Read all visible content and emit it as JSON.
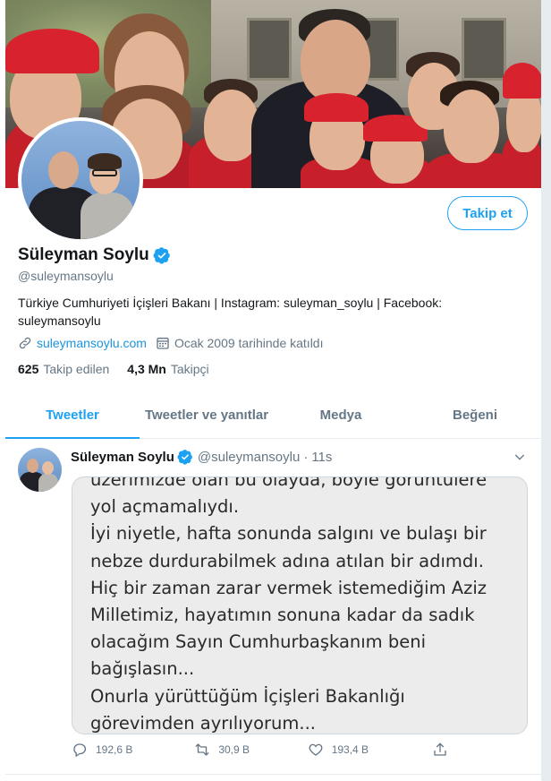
{
  "profile": {
    "name": "Süleyman Soylu",
    "handle": "@suleymansoylu",
    "follow_label": "Takip et",
    "bio": "Türkiye Cumhuriyeti İçişleri Bakanı | Instagram: suleyman_soylu | Facebook: suleymansoylu",
    "website": "suleymansoylu.com",
    "joined": "Ocak 2009 tarihinde katıldı",
    "following_count": "625",
    "following_label": "Takip edilen",
    "followers_count": "4,3 Mn",
    "followers_label": "Takipçi"
  },
  "tabs": [
    {
      "label": "Tweetler"
    },
    {
      "label": "Tweetler ve yanıtlar"
    },
    {
      "label": "Medya"
    },
    {
      "label": "Beğeni"
    }
  ],
  "tweet": {
    "name": "Süleyman Soylu",
    "handle": "@suleymansoylu",
    "sep": "·",
    "time": "11s",
    "image_text": [
      "üzerimizde olan bu olayda, böyle görüntülere",
      "yol açmamalıydı.",
      "İyi niyetle, hafta sonunda salgını ve bulaşı bir",
      "nebze durdurabilmek adına atılan bir adımdı.",
      "Hiç bir zaman zarar vermek istemediğim Aziz",
      "Milletimiz, hayatımın sonuna kadar da sadık",
      "olacağım Sayın Cumhurbaşkanım beni",
      "bağışlasın...",
      "Onurla yürüttüğüm İçişleri Bakanlığı",
      "görevimden ayrılıyorum..."
    ],
    "replies": "192,6 B",
    "retweets": "30,9 B",
    "likes": "193,4 B"
  },
  "colors": {
    "accent": "#1da1f2",
    "link": "#1b95e0",
    "muted": "#657786"
  },
  "icons": [
    "verified-badge-icon",
    "link-icon",
    "calendar-icon",
    "chevron-down-icon",
    "reply-icon",
    "retweet-icon",
    "like-icon",
    "share-icon"
  ]
}
